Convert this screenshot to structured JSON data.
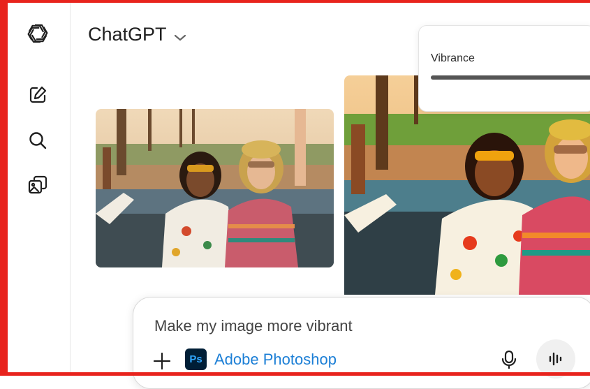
{
  "header": {
    "title": "ChatGPT"
  },
  "sidebar": {
    "items": [
      {
        "icon": "openai-logo-icon"
      },
      {
        "icon": "new-chat-icon"
      },
      {
        "icon": "search-icon"
      },
      {
        "icon": "library-images-icon"
      }
    ]
  },
  "images": [
    {
      "description_icon": "photo-original"
    },
    {
      "description_icon": "photo-vibrant"
    }
  ],
  "adjustment_panel": {
    "label": "Vibrance",
    "value_fraction": 1.0
  },
  "composer": {
    "prompt": "Make my image more vibrant",
    "app_chip_logo": "Ps",
    "app_chip_label": "Adobe Photoshop"
  },
  "colors": {
    "frame": "#e8231d",
    "photoshop_bg": "#001e36",
    "photoshop_fg": "#31a8ff",
    "app_link": "#1c7fd6"
  }
}
